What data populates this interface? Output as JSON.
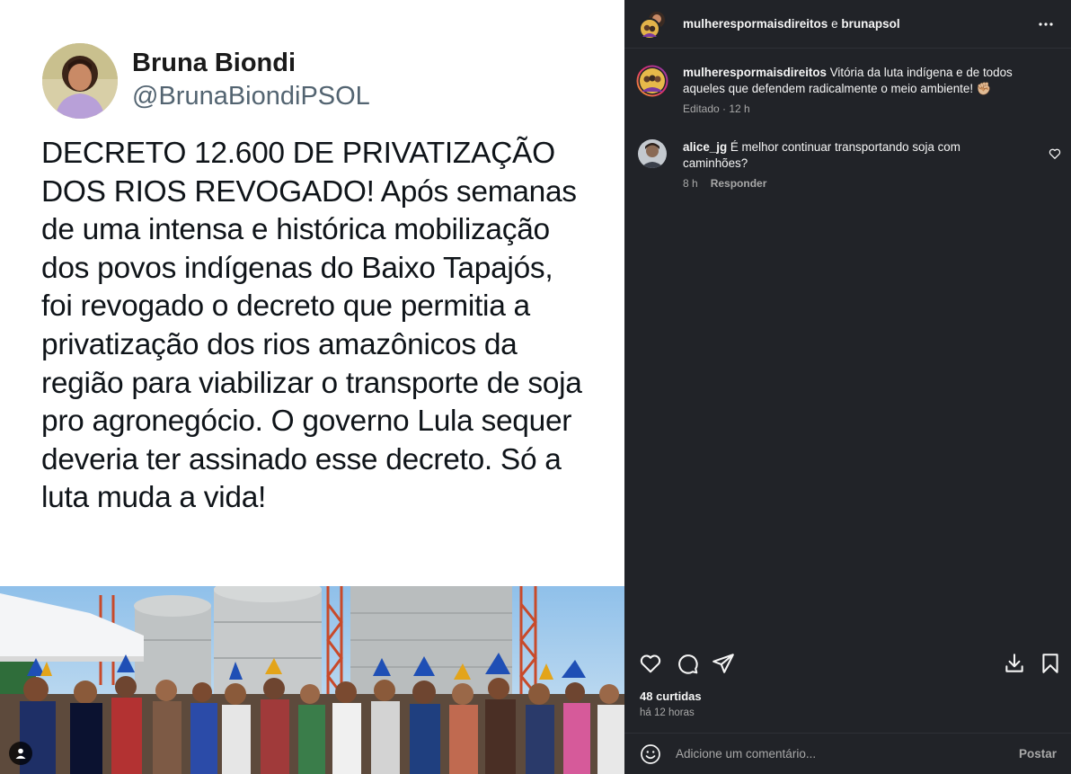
{
  "post": {
    "tweet": {
      "name": "Bruna Biondi",
      "handle": "@BrunaBiondiPSOL",
      "text": "DECRETO 12.600 DE PRIVATIZAÇÃO DOS RIOS REVOGADO! Após semanas de uma intensa e histórica mobilização dos povos indígenas do Baixo Tapajós, foi revogado o decreto que permitia a privatização dos rios amazônicos da região para viabilizar o transporte de soja pro agronegócio. O governo Lula sequer deveria ter assinado esse decreto. Só a luta muda a vida!"
    },
    "photo_icon": "user-tag-icon"
  },
  "sidebar": {
    "header": {
      "author1": "mulherespormaisdireitos",
      "separator": " e ",
      "author2": "brunapsol",
      "more_icon": "more-horizontal-icon"
    },
    "caption": {
      "user": "mulherespormaisdireitos",
      "text": " Vitória da luta indígena e de todos aqueles que defendem radicalmente o meio ambiente! ✊🏼",
      "meta_edited": "Editado",
      "meta_dot": " · ",
      "meta_time": "12 h"
    },
    "comments": [
      {
        "user": "alice_jg",
        "text": " É melhor continuar transportando soja com caminhões?",
        "time": "8 h",
        "reply_label": "Responder"
      }
    ],
    "actions": {
      "icons": [
        "heart-icon",
        "comment-icon",
        "share-icon",
        "download-icon",
        "bookmark-icon"
      ]
    },
    "likes": "48 curtidas",
    "time_ago": "há 12 horas",
    "add_comment": {
      "placeholder": "Adicione um comentário...",
      "post_label": "Postar"
    }
  },
  "colors": {
    "sidebar_bg": "#212328",
    "text_primary": "#f5f5f5",
    "text_secondary": "#a8a8a8",
    "tweet_handle": "#536471"
  }
}
